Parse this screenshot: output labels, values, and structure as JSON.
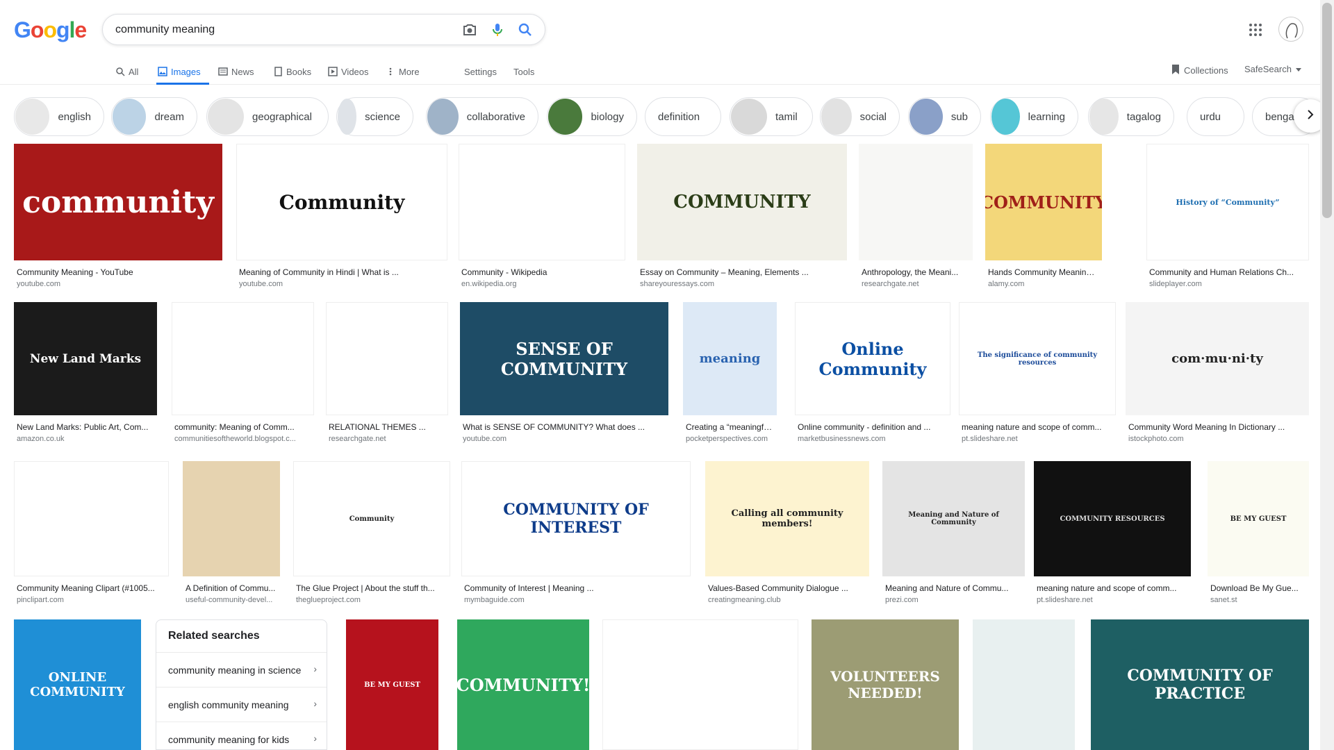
{
  "logo": {
    "letters": [
      "G",
      "o",
      "o",
      "g",
      "l",
      "e"
    ],
    "colors": [
      "#4285F4",
      "#EA4335",
      "#FBBC05",
      "#4285F4",
      "#34A853",
      "#EA4335"
    ]
  },
  "search": {
    "value": "community meaning",
    "placeholder": ""
  },
  "tabs": [
    {
      "label": "All",
      "icon": "search-icon"
    },
    {
      "label": "Images",
      "icon": "image-icon",
      "active": true
    },
    {
      "label": "News",
      "icon": "news-icon"
    },
    {
      "label": "Books",
      "icon": "book-icon"
    },
    {
      "label": "Videos",
      "icon": "video-icon"
    },
    {
      "label": "More",
      "icon": "more-vert-icon"
    }
  ],
  "settings_label": "Settings",
  "tools_label": "Tools",
  "collections_label": "Collections",
  "safesearch_label": "SafeSearch",
  "chips": [
    {
      "label": "english",
      "thumb": "#e8e8e8"
    },
    {
      "label": "dream",
      "thumb": "#bcd3e6"
    },
    {
      "label": "geographical",
      "thumb": "#e4e4e4"
    },
    {
      "label": "science",
      "thumb": "#dfe3e8"
    },
    {
      "label": "collaborative",
      "thumb": "#9fb3c8"
    },
    {
      "label": "biology",
      "thumb": "#4a7a3c"
    },
    {
      "label": "definition",
      "thumb": ""
    },
    {
      "label": "tamil",
      "thumb": "#d9d9d9"
    },
    {
      "label": "social",
      "thumb": "#e2e2e2"
    },
    {
      "label": "sub",
      "thumb": "#8aa0c8"
    },
    {
      "label": "learning",
      "thumb": "#55c6d6"
    },
    {
      "label": "tagalog",
      "thumb": "#e6e6e6"
    },
    {
      "label": "urdu",
      "thumb": ""
    },
    {
      "label": "bengali",
      "thumb": ""
    }
  ],
  "results": [
    {
      "caption": "Community Meaning - YouTube",
      "source": "youtube.com",
      "text": "community"
    },
    {
      "caption": "Meaning of Community in Hindi | What is ...",
      "source": "youtube.com",
      "text": "Community"
    },
    {
      "caption": "Community - Wikipedia",
      "source": "en.wikipedia.org",
      "text": ""
    },
    {
      "caption": "Essay on Community – Meaning, Elements ...",
      "source": "shareyouressays.com",
      "text": "COMMUNITY"
    },
    {
      "caption": "Anthropology, the Meani...",
      "source": "researchgate.net",
      "text": ""
    },
    {
      "caption": "Hands Community Meaning Orga...",
      "source": "alamy.com",
      "text": "COMMUNITY"
    },
    {
      "caption": "Community and Human Relations Ch...",
      "source": "slideplayer.com",
      "text": "History of “Community”"
    },
    {
      "caption": "New Land Marks: Public Art, Com...",
      "source": "amazon.co.uk",
      "text": "New Land Marks"
    },
    {
      "caption": "community: Meaning of Comm...",
      "source": "communitiesoftheworld.blogspot.c...",
      "text": ""
    },
    {
      "caption": "RELATIONAL THEMES ...",
      "source": "researchgate.net",
      "text": ""
    },
    {
      "caption": "What is SENSE OF COMMUNITY? What does ...",
      "source": "youtube.com",
      "text": "SENSE OF COMMUNITY"
    },
    {
      "caption": "Creating a “meaningfu...",
      "source": "pocketperspectives.com",
      "text": "meaning"
    },
    {
      "caption": "Online community - definition and ...",
      "source": "marketbusinessnews.com",
      "text": "Online Community"
    },
    {
      "caption": "meaning nature and scope of comm...",
      "source": "pt.slideshare.net",
      "text": "The significance of community resources"
    },
    {
      "caption": "Community Word Meaning In Dictionary ...",
      "source": "istockphoto.com",
      "text": "com·mu·ni·ty"
    },
    {
      "caption": "Community Meaning Clipart (#1005...",
      "source": "pinclipart.com",
      "text": ""
    },
    {
      "caption": "A Definition of Commu...",
      "source": "useful-community-devel...",
      "text": ""
    },
    {
      "caption": "The Glue Project | About the stuff th...",
      "source": "theglueproject.com",
      "text": "Community"
    },
    {
      "caption": "Community of Interest | Meaning ...",
      "source": "mymbaguide.com",
      "text": "COMMUNITY OF INTEREST"
    },
    {
      "caption": "Values-Based Community Dialogue ...",
      "source": "creatingmeaning.club",
      "text": "Calling all community members!"
    },
    {
      "caption": "Meaning and Nature of Commu...",
      "source": "prezi.com",
      "text": "Meaning and Nature of Community"
    },
    {
      "caption": "meaning nature and scope of comm...",
      "source": "pt.slideshare.net",
      "text": "COMMUNITY RESOURCES"
    },
    {
      "caption": "Download Be My Gue...",
      "source": "sanet.st",
      "text": "BE MY GUEST"
    },
    {
      "caption": "",
      "source": "",
      "text": "ONLINE COMMUNITY"
    },
    {
      "caption": "",
      "source": "",
      "text": "BE MY GUEST"
    },
    {
      "caption": "",
      "source": "",
      "text": "COMMUNITY!"
    },
    {
      "caption": "",
      "source": "",
      "text": ""
    },
    {
      "caption": "",
      "source": "",
      "text": "VOLUNTEERS NEEDED!"
    },
    {
      "caption": "",
      "source": "",
      "text": ""
    },
    {
      "caption": "",
      "source": "",
      "text": "COMMUNITY OF PRACTICE"
    }
  ],
  "related": {
    "title": "Related searches",
    "items": [
      "community meaning in science",
      "english community meaning",
      "community meaning for kids"
    ]
  }
}
